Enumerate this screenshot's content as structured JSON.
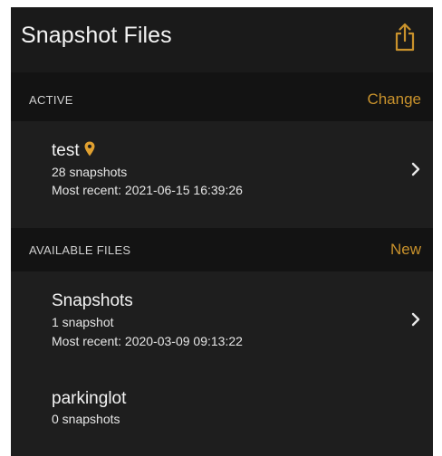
{
  "colors": {
    "accent": "#c9922c",
    "background": "#131313",
    "cell_background": "#1e1e1e"
  },
  "nav": {
    "title": "Snapshot Files",
    "share_icon": "share-icon"
  },
  "active": {
    "header": "ACTIVE",
    "action": "Change",
    "file": {
      "name": "test",
      "count": "28 snapshots",
      "recent": "Most recent: 2021-06-15 16:39:26",
      "badge_icon": "location-pin-icon"
    }
  },
  "available": {
    "header": "AVAILABLE FILES",
    "action": "New",
    "files": [
      {
        "name": "Snapshots",
        "count": "1 snapshot",
        "recent": "Most recent: 2020-03-09 09:13:22"
      },
      {
        "name": "parkinglot",
        "count": "0 snapshots"
      }
    ]
  }
}
